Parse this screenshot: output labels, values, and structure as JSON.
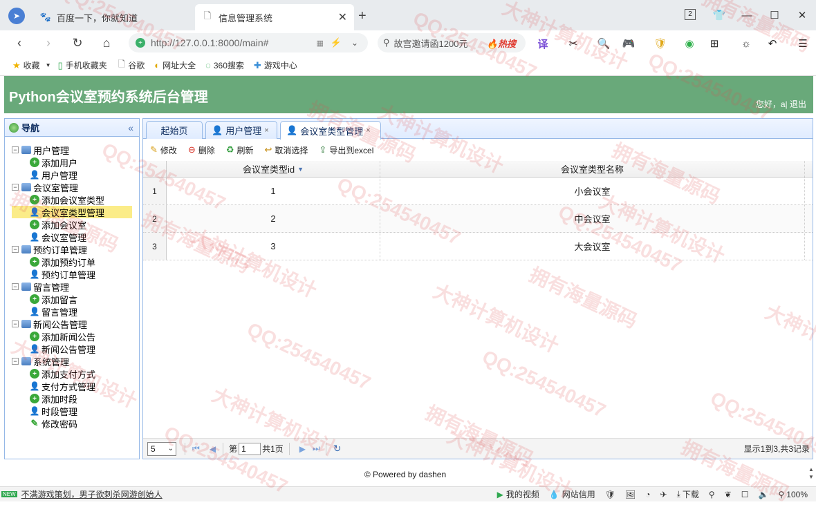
{
  "browser": {
    "tabs": [
      {
        "label": "百度一下，你就知道"
      },
      {
        "label": "信息管理系统"
      }
    ],
    "url": "http://127.0.0.1:8000/main#",
    "search_text": "故宫邀请函1200元",
    "hot_label": "热搜",
    "tab_count": "2",
    "bookmarks": [
      "收藏",
      "手机收藏夹",
      "谷歌",
      "网址大全",
      "360搜索",
      "游戏中心"
    ]
  },
  "app": {
    "title": "Python会议室预约系统后台管理",
    "greeting": "您好，a| 退出",
    "nav_title": "导航",
    "tree": [
      {
        "label": "用户管理",
        "children": [
          "添加用户",
          "用户管理"
        ]
      },
      {
        "label": "会议室管理",
        "children": [
          "添加会议室类型",
          "会议室类型管理",
          "添加会议室",
          "会议室管理"
        ]
      },
      {
        "label": "预约订单管理",
        "children": [
          "添加预约订单",
          "预约订单管理"
        ]
      },
      {
        "label": "留言管理",
        "children": [
          "添加留言",
          "留言管理"
        ]
      },
      {
        "label": "新闻公告管理",
        "children": [
          "添加新闻公告",
          "新闻公告管理"
        ]
      },
      {
        "label": "系统管理",
        "children": [
          "添加支付方式",
          "支付方式管理",
          "添加时段",
          "时段管理",
          "修改密码"
        ]
      }
    ],
    "selected_item": "会议室类型管理",
    "tabs": [
      {
        "label": "起始页",
        "closable": false
      },
      {
        "label": "用户管理",
        "closable": true
      },
      {
        "label": "会议室类型管理",
        "closable": true
      }
    ],
    "toolbar": {
      "edit": "修改",
      "delete": "删除",
      "refresh": "刷新",
      "deselect": "取消选择",
      "export": "导出到excel"
    },
    "grid": {
      "columns": [
        "会议室类型id",
        "会议室类型名称"
      ],
      "rows": [
        {
          "num": "1",
          "id": "1",
          "name": "小会议室"
        },
        {
          "num": "2",
          "id": "2",
          "name": "中会议室"
        },
        {
          "num": "3",
          "id": "3",
          "name": "大会议室"
        }
      ]
    },
    "pager": {
      "page_size": "5",
      "page_prefix": "第",
      "page_value": "1",
      "page_total": "共1页",
      "summary": "显示1到3,共3记录"
    },
    "footer": "© Powered by dashen"
  },
  "statusbar": {
    "news": "不满游戏策划，男子欲刺杀网游创始人",
    "items": [
      "我的视频",
      "网站信用",
      "下载"
    ],
    "zoom": "100%"
  },
  "watermarks": [
    "QQ:254540457",
    "大神计算机设计",
    "拥有海量源码"
  ]
}
